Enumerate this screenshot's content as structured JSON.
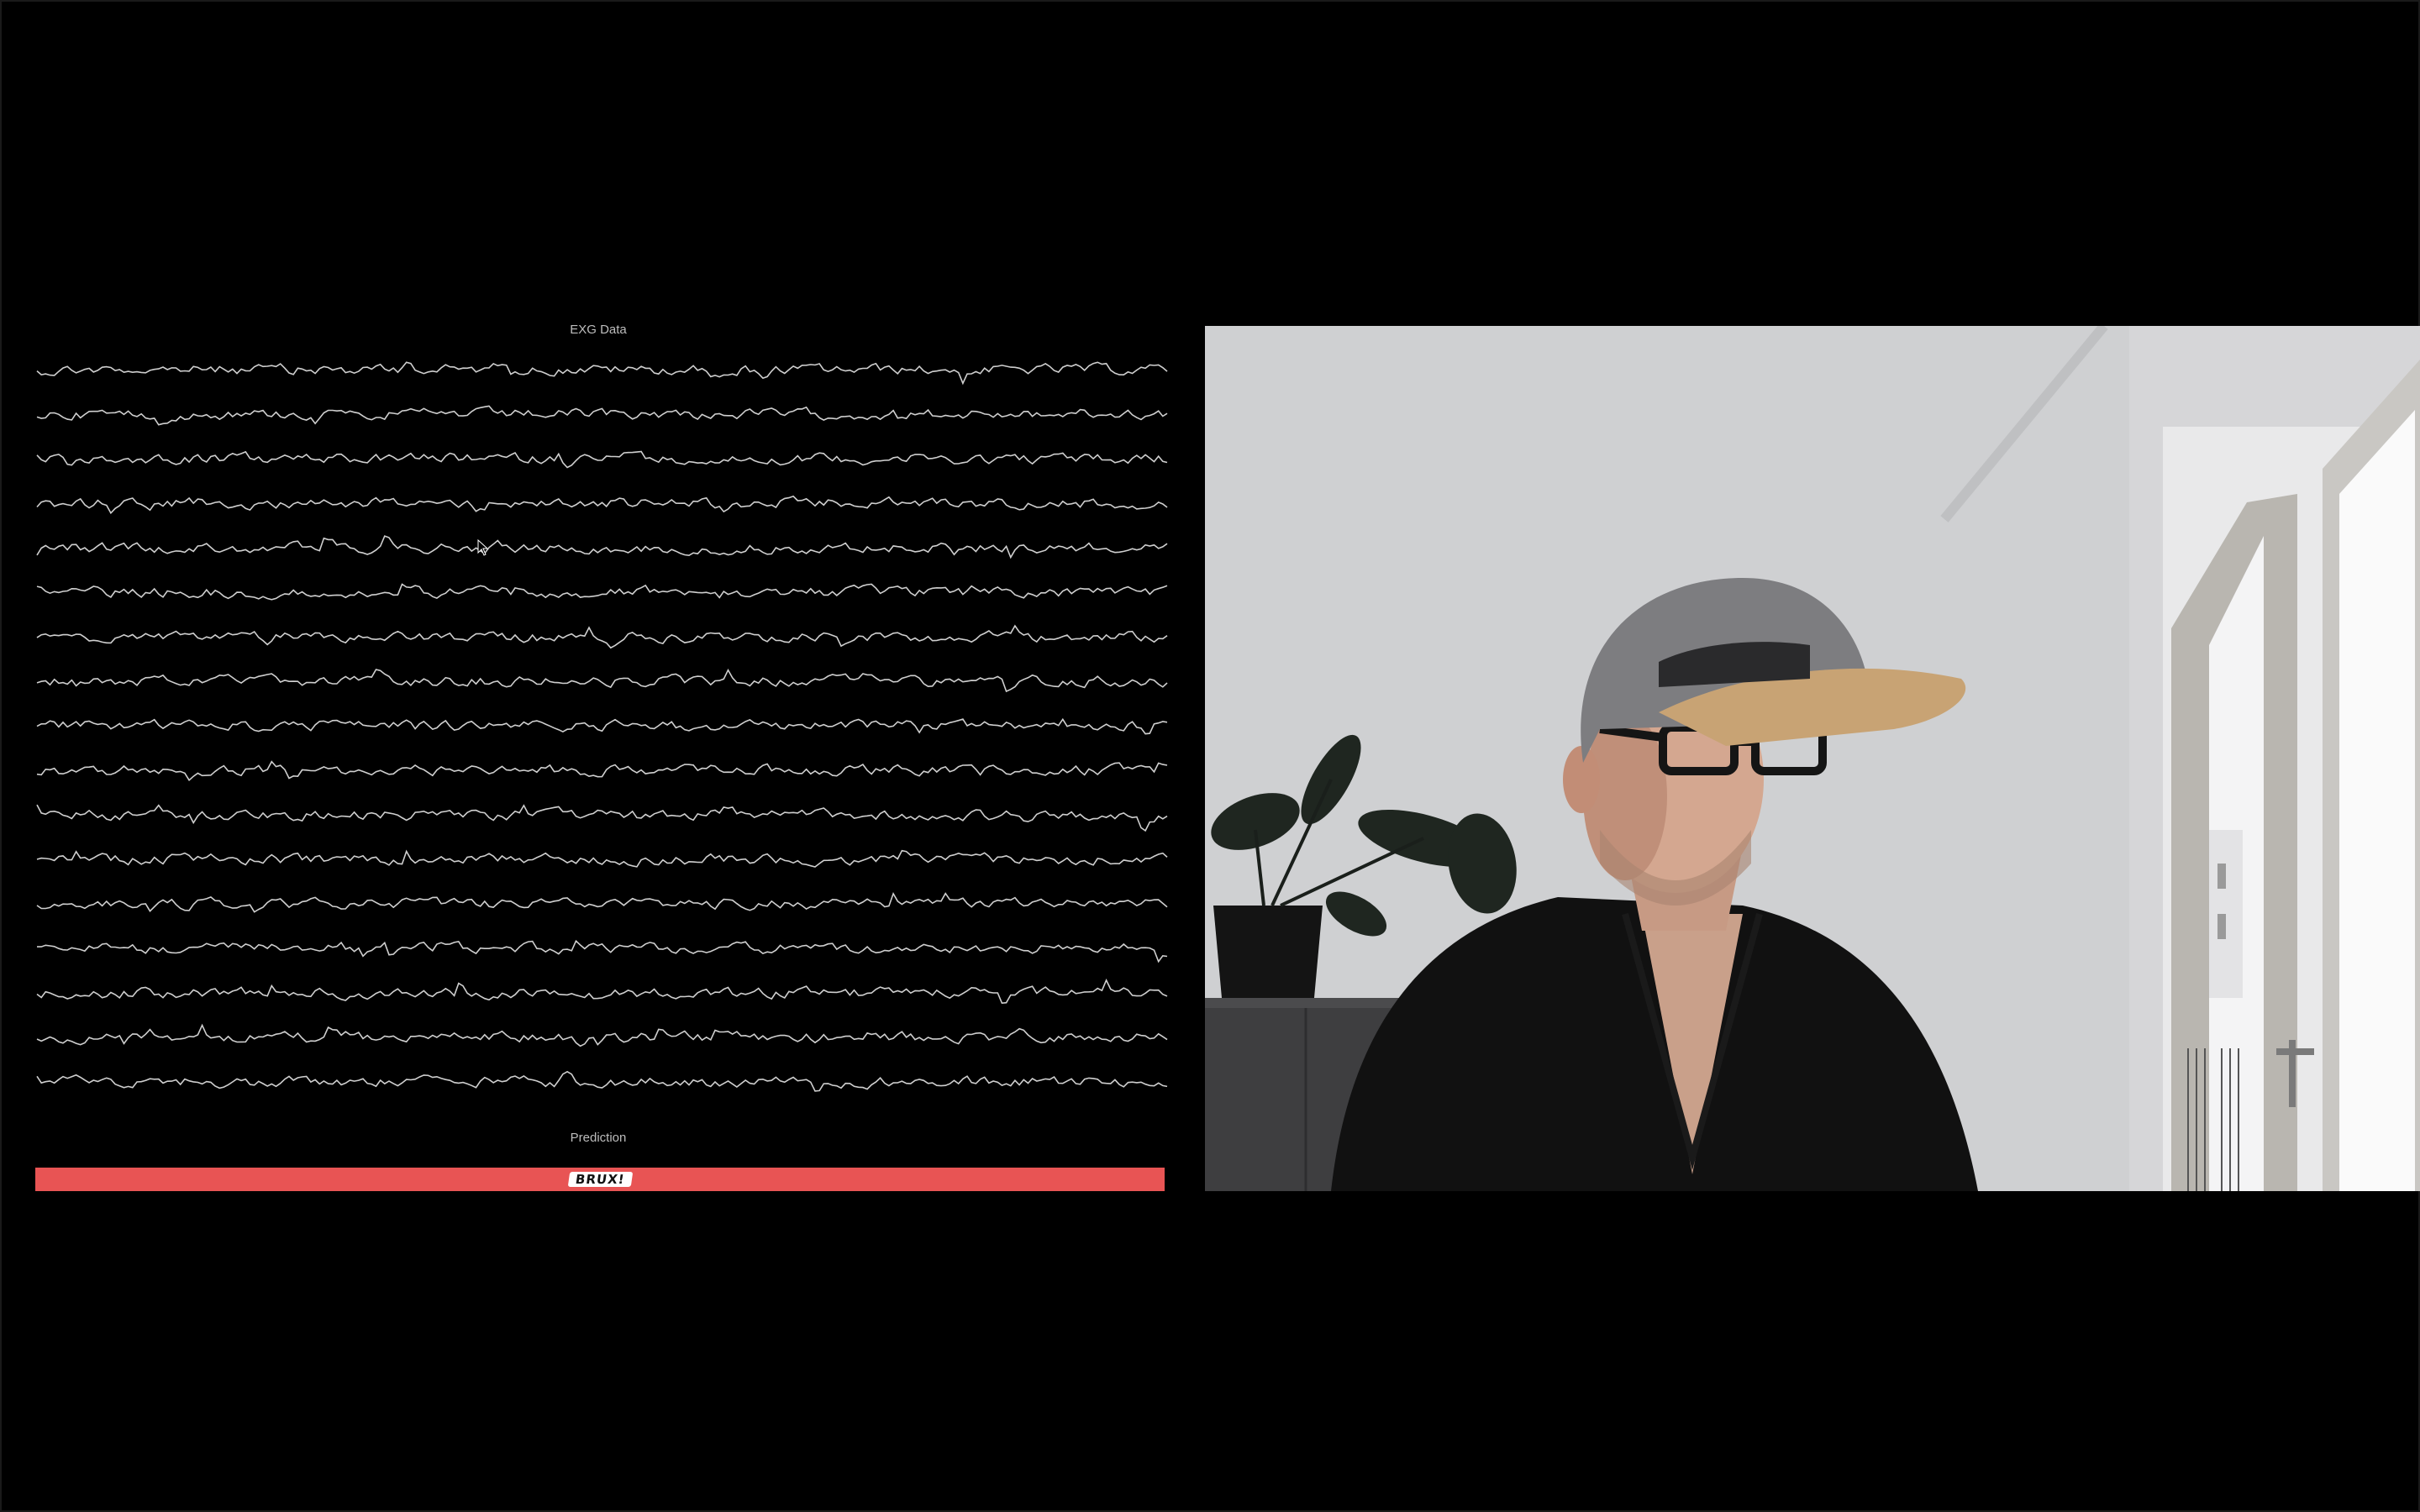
{
  "eeg": {
    "title": "EXG Data",
    "channel_count": 17,
    "trace_color": "#cfcfcf"
  },
  "prediction": {
    "label": "Prediction",
    "logo_text": "BRUX!",
    "bar_color": "#e85454"
  },
  "webcam": {
    "description_icon": "webcam-feed"
  }
}
